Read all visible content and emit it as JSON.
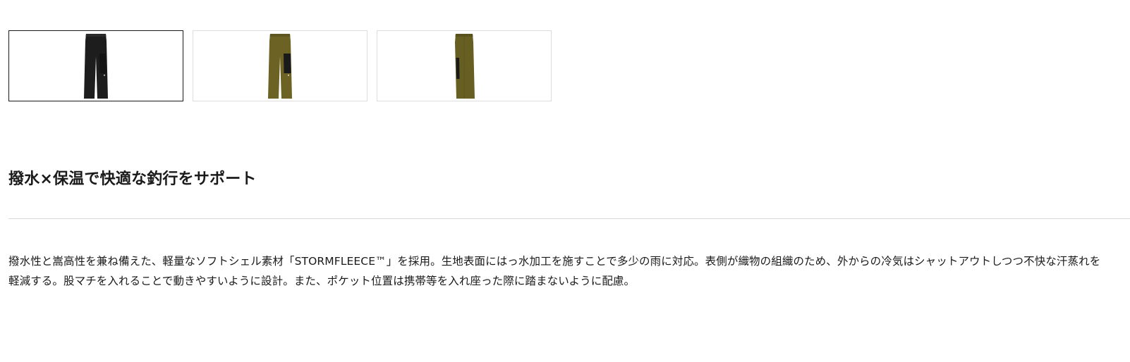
{
  "gallery": {
    "thumbnails": [
      {
        "color_name": "black",
        "fill": "#1c1d1c",
        "panel": "#141414",
        "selected": true
      },
      {
        "color_name": "olive",
        "fill": "#6b6223",
        "panel": "#1a1a1a",
        "selected": false
      },
      {
        "color_name": "olive",
        "fill": "#675e22",
        "panel": "#1a1a1a",
        "selected": false
      }
    ]
  },
  "headline": "撥水×保温で快適な釣行をサポート",
  "description": "撥水性と嵩高性を兼ね備えた、軽量なソフトシェル素材「STORMFLEECE™」を採用。生地表面にはっ水加工を施すことで多少の雨に対応。表側が織物の組織のため、外からの冷気はシャットアウトしつつ不快な汗蒸れを軽減する。股マチを入れることで動きやすいように設計。また、ポケット位置は携帯等を入れ座った際に踏まないように配慮。",
  "colors": {
    "text": "#1a1a1a",
    "divider": "#d8d8d8",
    "selected_border": "#1a1a1a",
    "thumb_border": "#dddddd"
  }
}
